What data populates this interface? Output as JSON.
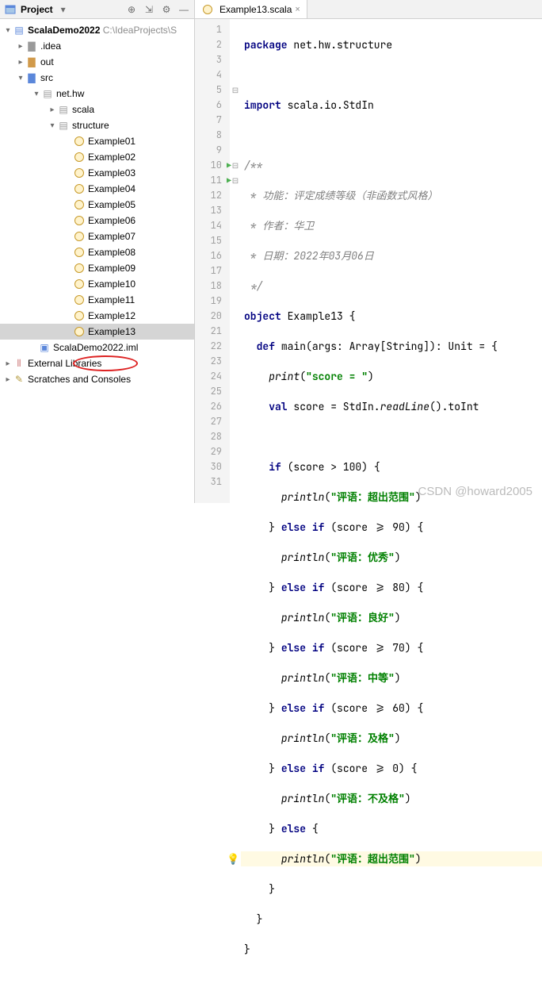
{
  "header": {
    "title": "Project"
  },
  "tab": {
    "label": "Example13.scala"
  },
  "tree": {
    "root": "ScalaDemo2022",
    "root_path": "C:\\IdeaProjects\\S",
    "idea": ".idea",
    "out": "out",
    "src": "src",
    "pkg": "net.hw",
    "scala_dir": "scala",
    "structure": "structure",
    "examples": [
      "Example01",
      "Example02",
      "Example03",
      "Example04",
      "Example05",
      "Example06",
      "Example07",
      "Example08",
      "Example09",
      "Example10",
      "Example11",
      "Example12",
      "Example13"
    ],
    "iml": "ScalaDemo2022.iml",
    "ext_lib": "External Libraries",
    "scratches": "Scratches and Consoles"
  },
  "code": {
    "l1a": "package",
    "l1b": " net.hw.structure",
    "l3a": "import",
    "l3b": " scala.io.StdIn",
    "l5": "/**",
    "l6": " * 功能：评定成绩等级（非函数式风格）",
    "l7": " * 作者：华卫",
    "l8": " * 日期：2022年03月06日",
    "l9": " */",
    "l10a": "object",
    "l10b": " Example13 {",
    "l11a": "def",
    "l11b": " main(args: Array[",
    "l11c": "String",
    "l11d": "]): Unit = {",
    "l12a": "print",
    "l12b": "(",
    "l12c": "\"score = \"",
    "l12d": ")",
    "l13a": "val",
    "l13b": " score = StdIn.",
    "l13c": "readLine",
    "l13d": "().toInt",
    "l15a": "if",
    "l15b": " (score > ",
    "l15c": "100",
    "l15d": ") {",
    "l16a": "println",
    "l16b": "(",
    "l16c": "\"评语：超出范围\"",
    "l16d": ")",
    "l17a": "} ",
    "l17b": "else if",
    "l17c": " (score >= ",
    "l17d": "90",
    "l17e": ") {",
    "l18a": "println",
    "l18b": "(",
    "l18c": "\"评语：优秀\"",
    "l18d": ")",
    "l19a": "} ",
    "l19b": "else if",
    "l19c": " (score >= ",
    "l19d": "80",
    "l19e": ") {",
    "l20a": "println",
    "l20b": "(",
    "l20c": "\"评语：良好\"",
    "l20d": ")",
    "l21a": "} ",
    "l21b": "else if",
    "l21c": " (score >= ",
    "l21d": "70",
    "l21e": ") {",
    "l22a": "println",
    "l22b": "(",
    "l22c": "\"评语：中等\"",
    "l22d": ")",
    "l23a": "} ",
    "l23b": "else if",
    "l23c": " (score >= ",
    "l23d": "60",
    "l23e": ") {",
    "l24a": "println",
    "l24b": "(",
    "l24c": "\"评语：及格\"",
    "l24d": ")",
    "l25a": "} ",
    "l25b": "else if",
    "l25c": " (score >= ",
    "l25d": "0",
    "l25e": ") {",
    "l26a": "println",
    "l26b": "(",
    "l26c": "\"评语：不及格\"",
    "l26d": ")",
    "l27a": "} ",
    "l27b": "else",
    "l27c": " {",
    "l28a": "println",
    "l28b": "(",
    "l28c": "\"评语：超出范围\"",
    "l28d": ")",
    "l29": "}",
    "l30": "}",
    "l31": "}"
  },
  "watermark": "CSDN @howard2005"
}
